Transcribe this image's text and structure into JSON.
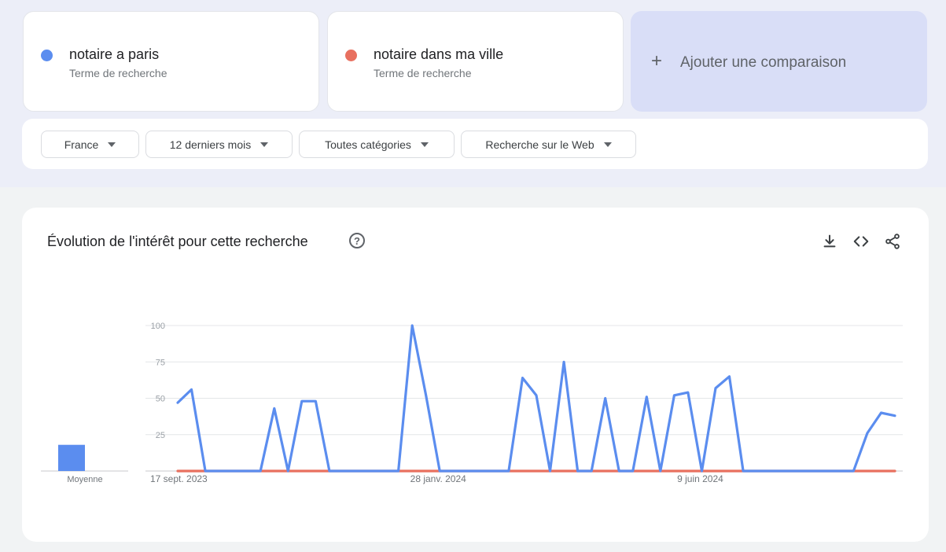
{
  "terms": [
    {
      "term": "notaire a paris",
      "sublabel": "Terme de recherche",
      "color": "#5b8def"
    },
    {
      "term": "notaire dans ma ville",
      "sublabel": "Terme de recherche",
      "color": "#e8705f"
    }
  ],
  "add_comparison": {
    "icon": "plus-icon",
    "label": "Ajouter une comparaison"
  },
  "filters": [
    {
      "label": "France"
    },
    {
      "label": "12 derniers mois"
    },
    {
      "label": "Toutes catégories"
    },
    {
      "label": "Recherche sur le Web"
    }
  ],
  "chart": {
    "title": "Évolution de l'intérêt pour cette recherche",
    "icons": [
      "help-icon",
      "download-icon",
      "embed-code-icon",
      "share-icon"
    ]
  },
  "chart_data": {
    "type": "line",
    "y_ticks": [
      "25",
      "50",
      "75",
      "100"
    ],
    "ylim": [
      0,
      100
    ],
    "x_tick_labels": [
      {
        "label": "17 sept. 2023",
        "index": 0
      },
      {
        "label": "28 janv. 2024",
        "index": 19
      },
      {
        "label": "9 juin 2024",
        "index": 38
      }
    ],
    "grid": true,
    "average": {
      "label": "Moyenne",
      "values": [
        18,
        0
      ]
    },
    "series": [
      {
        "name": "notaire a paris",
        "color": "#5b8def",
        "values": [
          47,
          56,
          0,
          0,
          0,
          0,
          0,
          43,
          0,
          48,
          48,
          0,
          0,
          0,
          0,
          0,
          0,
          100,
          52,
          0,
          0,
          0,
          0,
          0,
          0,
          64,
          52,
          0,
          75,
          0,
          0,
          50,
          0,
          0,
          51,
          0,
          52,
          54,
          0,
          57,
          65,
          0,
          0,
          0,
          0,
          0,
          0,
          0,
          0,
          0,
          26,
          40,
          38
        ]
      },
      {
        "name": "notaire dans ma ville",
        "color": "#e8705f",
        "values": [
          0,
          0,
          0,
          0,
          0,
          0,
          0,
          0,
          0,
          0,
          0,
          0,
          0,
          0,
          0,
          0,
          0,
          0,
          0,
          0,
          0,
          0,
          0,
          0,
          0,
          0,
          0,
          0,
          0,
          0,
          0,
          0,
          0,
          0,
          0,
          0,
          0,
          0,
          0,
          0,
          0,
          0,
          0,
          0,
          0,
          0,
          0,
          0,
          0,
          0,
          0,
          0,
          0
        ]
      }
    ]
  }
}
